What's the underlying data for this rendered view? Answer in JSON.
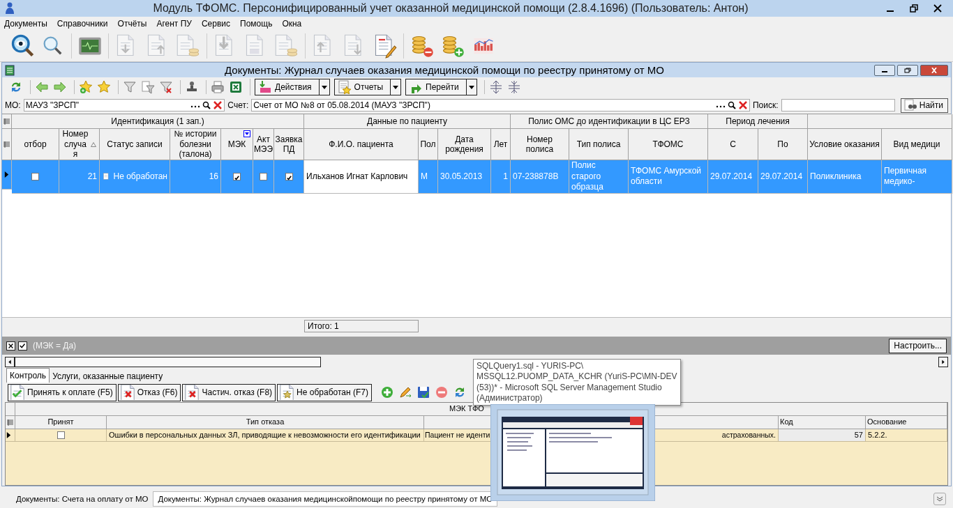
{
  "window": {
    "title": "Модуль ТФОМС. Персонифицированный учет оказанной медицинской помощи (2.8.4.1696) (Пользователь: Антон)"
  },
  "menu": [
    "Документы",
    "Справочники",
    "Отчёты",
    "Агент ПУ",
    "Сервис",
    "Помощь",
    "Окна"
  ],
  "toolbar": [
    [
      {
        "disabled": false
      },
      {
        "disabled": false
      }
    ],
    [
      {
        "disabled": false
      }
    ],
    [
      {
        "disabled": true
      },
      {
        "disabled": true
      },
      {
        "disabled": true
      }
    ],
    [
      {
        "disabled": true
      },
      {
        "disabled": true
      },
      {
        "disabled": true
      }
    ],
    [
      {
        "disabled": true
      },
      {
        "disabled": true
      },
      {
        "disabled": false
      }
    ],
    [
      {
        "disabled": false
      },
      {
        "disabled": false
      },
      {
        "disabled": false
      }
    ]
  ],
  "document": {
    "title": "Документы: Журнал случаев оказания медицинской помощи по реестру принятому от МО",
    "menu_buttons": [
      "Действия",
      "Отчеты",
      "Перейти"
    ]
  },
  "filters": {
    "mo_label": "МО:",
    "mo_value": "МАУЗ \"ЗРСП\"",
    "account_label": "Счет:",
    "account_value": "Счет от МО №8 от 05.08.2014 (МАУЗ \"ЗРСП\")",
    "search_label": "Поиск:",
    "find_button": "Найти"
  },
  "table": {
    "groups": [
      {
        "label": "Идентификация (1 зап.)",
        "columns": [
          {
            "label": "отбор",
            "sorted": false,
            "filtered": false
          },
          {
            "label": "Номер случая",
            "sorted": true,
            "filtered": false
          },
          {
            "label": "Статус записи",
            "sorted": false,
            "filtered": false
          },
          {
            "label": "№ истории болезни (талона)",
            "sorted": false,
            "filtered": false
          },
          {
            "label": "МЭК",
            "sorted": false,
            "filtered": true
          },
          {
            "label": "Акт МЭЭ",
            "sorted": false,
            "filtered": false
          },
          {
            "label": "Заявка ПД",
            "sorted": false,
            "filtered": false
          }
        ]
      },
      {
        "label": "Данные по пациенту",
        "columns": [
          {
            "label": "Ф.И.О. пациента",
            "sorted": false,
            "filtered": false
          },
          {
            "label": "Пол",
            "sorted": false,
            "filtered": false
          },
          {
            "label": "Дата рождения",
            "sorted": false,
            "filtered": false
          },
          {
            "label": "Лет",
            "sorted": false,
            "filtered": false
          }
        ]
      },
      {
        "label": "Полис ОМС до идентификации в ЦС ЕРЗ",
        "columns": [
          {
            "label": "Номер полиса",
            "sorted": false,
            "filtered": false
          },
          {
            "label": "Тип полиса",
            "sorted": false,
            "filtered": false
          },
          {
            "label": "ТФОМС",
            "sorted": false,
            "filtered": false
          }
        ]
      },
      {
        "label": "Период лечения",
        "columns": [
          {
            "label": "С",
            "sorted": false,
            "filtered": false
          },
          {
            "label": "По",
            "sorted": false,
            "filtered": false
          }
        ]
      },
      {
        "columns": [
          {
            "label": "Условие оказания",
            "sorted": false,
            "filtered": false
          },
          {
            "label": "Вид медици",
            "sorted": false,
            "filtered": false
          }
        ]
      }
    ],
    "rows": [
      {
        "selected": true,
        "cells": [
          {
            "kind": "check",
            "checked": false,
            "focused": false
          },
          {
            "kind": "number",
            "text": "21",
            "focused": false
          },
          {
            "kind": "status",
            "text": "Не обработан",
            "focused": false
          },
          {
            "kind": "number",
            "text": "16",
            "focused": false
          },
          {
            "kind": "check",
            "checked": true,
            "focused": false
          },
          {
            "kind": "check",
            "checked": false,
            "focused": false
          },
          {
            "kind": "check",
            "checked": true,
            "focused": false
          },
          {
            "kind": "text",
            "text": "Ильханов Игнат Карлович",
            "focused": true
          },
          {
            "kind": "text",
            "text": "М",
            "focused": false
          },
          {
            "kind": "text",
            "text": "30.05.2013",
            "focused": false
          },
          {
            "kind": "number",
            "text": "1",
            "focused": false
          },
          {
            "kind": "text",
            "text": "07-238878В",
            "focused": false
          },
          {
            "kind": "text",
            "text": "Полис старого образца",
            "focused": false
          },
          {
            "kind": "text",
            "text": "ТФОМС Амурской области",
            "focused": false
          },
          {
            "kind": "text",
            "text": "29.07.2014",
            "focused": false
          },
          {
            "kind": "text",
            "text": "29.07.2014",
            "focused": false
          },
          {
            "kind": "text",
            "text": "Поликлиника",
            "focused": false
          },
          {
            "kind": "text",
            "text": "Первичная медико-",
            "focused": false
          }
        ]
      }
    ],
    "total": "Итого: 1"
  },
  "filter_bar": {
    "enabled": true,
    "text": "(МЭК = Да)",
    "button": "Настроить..."
  },
  "tabs": [
    {
      "label": "Контроль",
      "selected": true
    },
    {
      "label": "Услуги, оказанные пациенту",
      "selected": false
    }
  ],
  "control_buttons": [
    "Принять к оплате (F5)",
    "Отказ (F6)",
    "Частич. отказ (F8)",
    "Не обработан (F7)"
  ],
  "mek": {
    "group": "МЭК ТФО",
    "columns": [
      "Принят",
      "Тип отказа",
      "Код",
      "Основание"
    ],
    "rows": [
      {
        "accepted": false,
        "type": "Ошибки в персональных данных ЗЛ, приводящие к невозможности его идентификации",
        "comment_start": "Пациент не иденти",
        "comment_end": "астрахованных.",
        "code": "57",
        "basis": "5.2.2."
      }
    ]
  },
  "tooltip": "SQLQuery1.sql - YURIS-PC\\\nMSSQL12.PUOMP_DATA_KCHR (YuriS-PC\\MN-DEV\n(53))* - Microsoft SQL Server Management Studio\n(Администратор)",
  "taskbar": [
    {
      "label": "Документы: Счета на оплату от МО",
      "selected": false
    },
    {
      "label": "Документы: Журнал случаев оказания медицинскойпомощи по реестру принятому от МО",
      "selected": true
    }
  ]
}
